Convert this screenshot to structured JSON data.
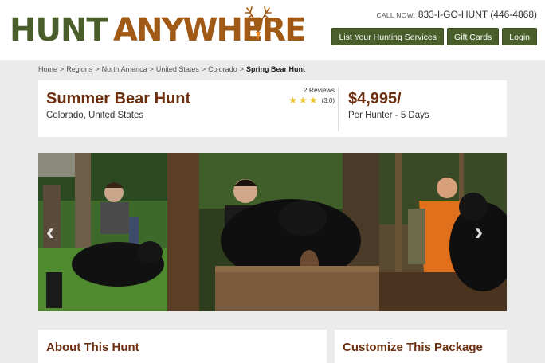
{
  "brand": {
    "logo_part1": "HUNT",
    "logo_part2": "ANYWHERE",
    "primary_color": "#4a5e2b",
    "accent_color": "#a05a16"
  },
  "header": {
    "call_label": "CALL NOW:",
    "call_number": "833-I-GO-HUNT (446-4868)",
    "nav": [
      {
        "label": "List Your Hunting Services"
      },
      {
        "label": "Gift Cards"
      },
      {
        "label": "Login"
      }
    ]
  },
  "breadcrumb": [
    "Home",
    "Regions",
    "North America",
    "United States",
    "Colorado",
    "Spring Bear Hunt"
  ],
  "listing": {
    "title": "Summer Bear Hunt",
    "location": "Colorado, United States",
    "reviews_count": "2 Reviews",
    "rating_text": "(3.0)",
    "stars": 3,
    "price": "$4,995/",
    "price_unit": "Per Hunter - 5 Days",
    "title_color": "#6b2f10"
  },
  "gallery": {
    "prev_icon": "chevron-double-left-icon",
    "next_icon": "chevron-double-right-icon",
    "prev_glyph": "‹‹",
    "next_glyph": "››"
  },
  "sections": {
    "about_title": "About This Hunt",
    "customize_title": "Customize This Package"
  }
}
